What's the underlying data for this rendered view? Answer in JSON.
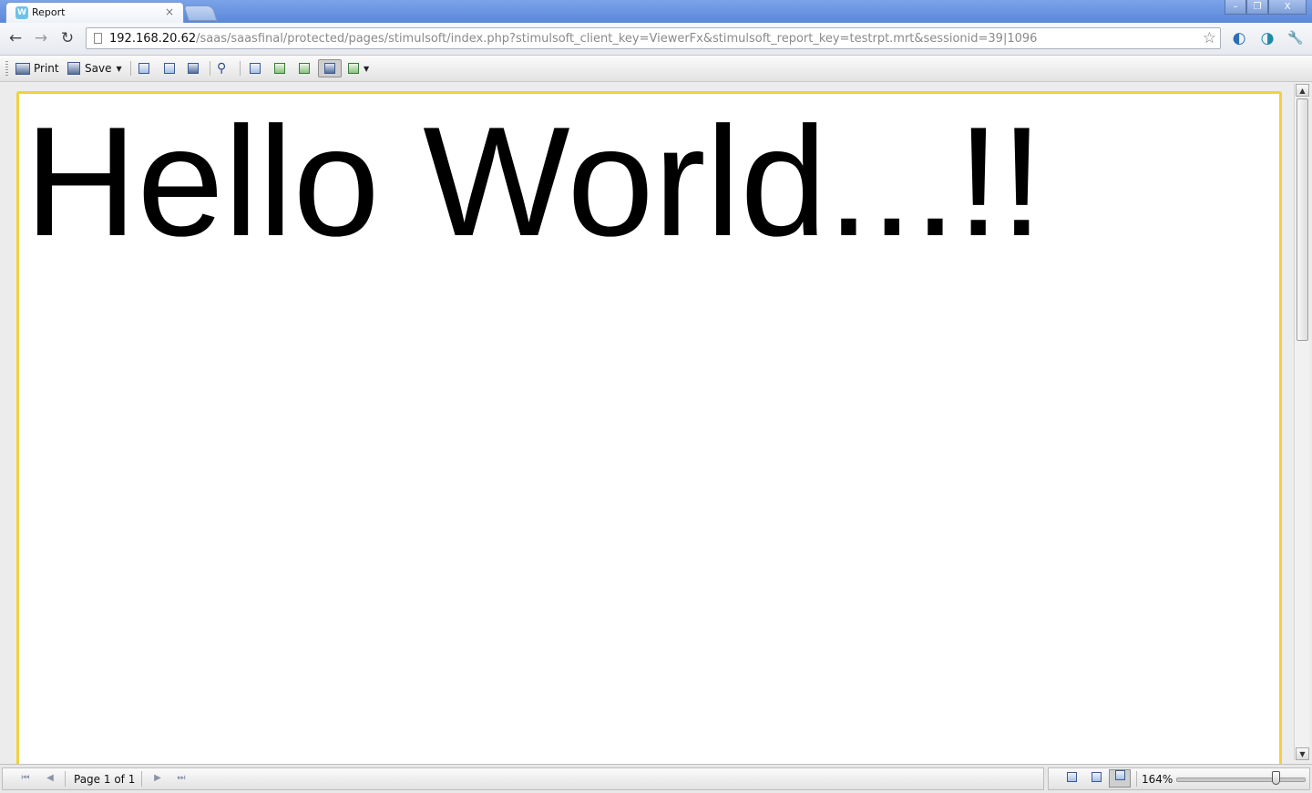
{
  "browser": {
    "tab": {
      "favicon": "W",
      "title": "Report",
      "close": "×"
    },
    "new_tab": "new-tab",
    "window_buttons": {
      "minimize": "–",
      "restore": "❐",
      "close": "X"
    },
    "nav": {
      "back": "←",
      "forward": "→",
      "reload": "↻"
    },
    "address": {
      "host": "192.168.20.62",
      "path": "/saas/saasfinal/protected/pages/stimulsoft/index.php?stimulsoft_client_key=ViewerFx&stimulsoft_report_key=testrpt.mrt&sessionid=39|1096"
    },
    "star": "☆",
    "extensions": {
      "ext1": "◐",
      "ext2": "◑",
      "wrench": "🔧"
    }
  },
  "toolbar": {
    "print_label": "Print",
    "save_label": "Save",
    "save_caret": "▼",
    "view_caret": "▼",
    "find_icon": "⚲"
  },
  "report": {
    "text": "Hello World...!!"
  },
  "statusbar": {
    "first": "⏮",
    "prev": "◀",
    "page_label": "Page 1 of 1",
    "next": "▶",
    "last": "⏭",
    "zoom_label": "164%"
  },
  "scrollbar": {
    "up": "▲",
    "down": "▼"
  }
}
